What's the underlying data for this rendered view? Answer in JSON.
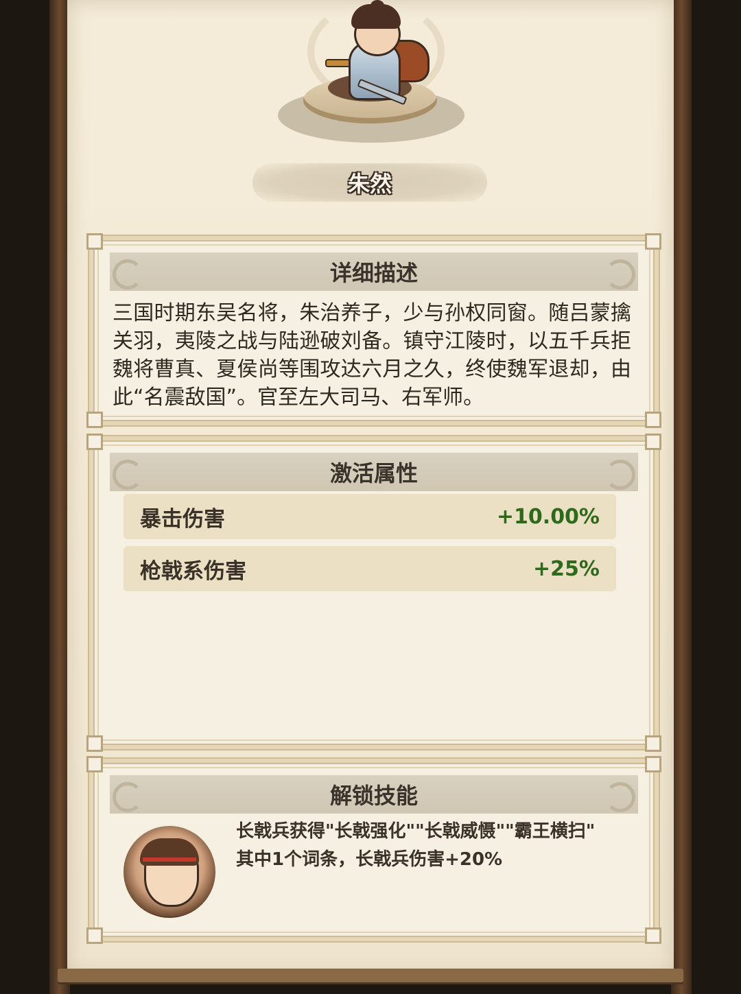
{
  "hero": {
    "name": "朱然"
  },
  "description": {
    "title": "详细描述",
    "text": "三国时期东吴名将，朱治养子，少与孙权同窗。随吕蒙擒关羽，夷陵之战与陆逊破刘备。镇守江陵时，以五千兵拒魏将曹真、夏侯尚等围攻达六月之久，终使魏军退却，由此“名震敌国”。官至左大司马、右军师。"
  },
  "attributes": {
    "title": "激活属性",
    "rows": [
      {
        "name": "暴击伤害",
        "value": "+10.00%"
      },
      {
        "name": "枪戟系伤害",
        "value": "+25%"
      }
    ]
  },
  "skill": {
    "title": "解锁技能",
    "line1": "长戟兵获得\"长戟强化\"\"长戟威慑\"\"霸王横扫\"",
    "line2": "其中1个词条，长戟兵伤害+20%"
  },
  "colors": {
    "value_green": "#2f6a1c",
    "header_bg": "#d9d1c0",
    "parchment": "#f4ecd9"
  }
}
